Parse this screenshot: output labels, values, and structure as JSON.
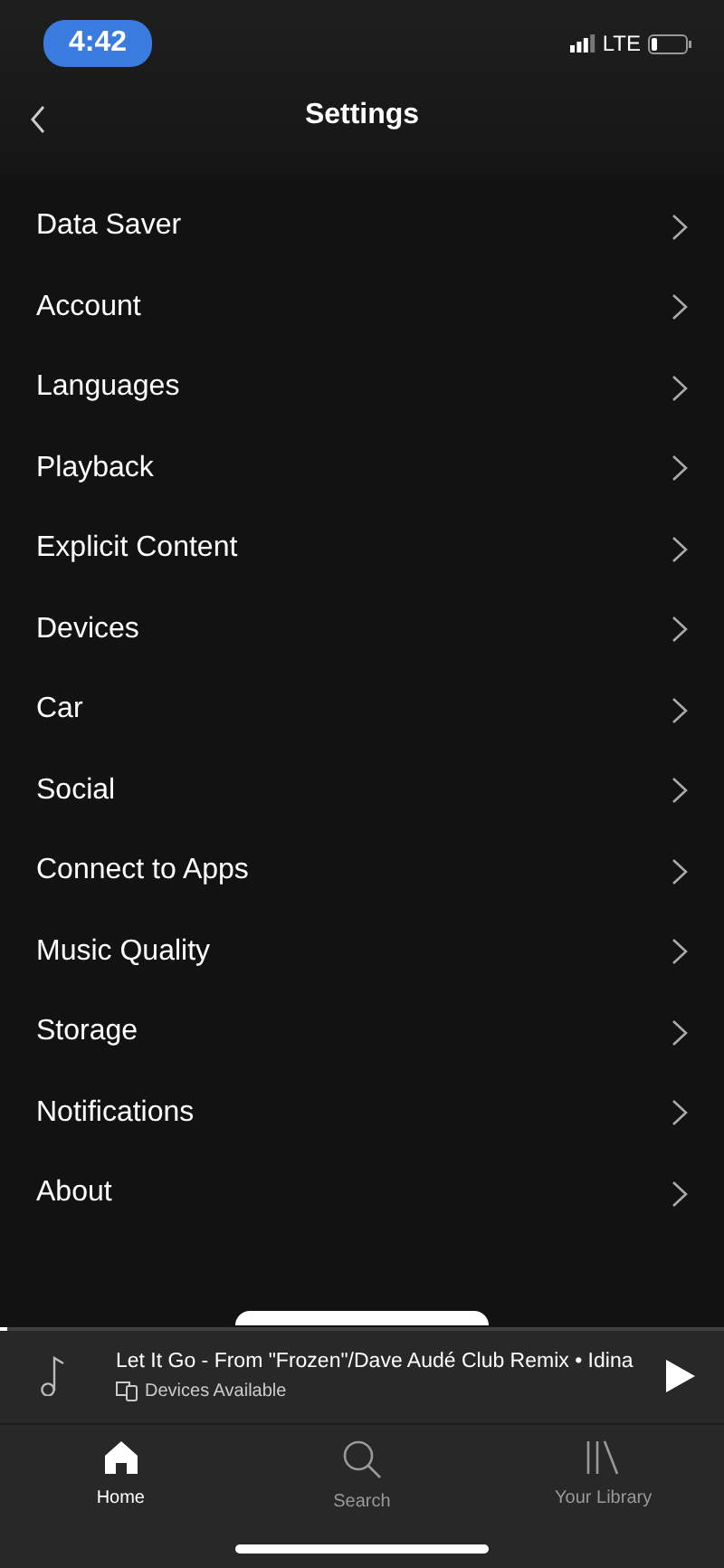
{
  "status_bar": {
    "time": "4:42",
    "network": "LTE"
  },
  "header": {
    "title": "Settings"
  },
  "settings_items": [
    {
      "label": "Data Saver"
    },
    {
      "label": "Account"
    },
    {
      "label": "Languages"
    },
    {
      "label": "Playback"
    },
    {
      "label": "Explicit Content"
    },
    {
      "label": "Devices"
    },
    {
      "label": "Car"
    },
    {
      "label": "Social"
    },
    {
      "label": "Connect to Apps"
    },
    {
      "label": "Music Quality"
    },
    {
      "label": "Storage"
    },
    {
      "label": "Notifications"
    },
    {
      "label": "About"
    }
  ],
  "now_playing": {
    "title": "Let It Go - From \"Frozen\"/Dave Audé Club Remix • Idina",
    "subtitle": "Devices Available",
    "level": 0.01
  },
  "tabs": [
    {
      "label": "Home",
      "selected": true
    },
    {
      "label": "Search",
      "selected": false
    },
    {
      "label": "Your Library",
      "selected": false
    }
  ]
}
